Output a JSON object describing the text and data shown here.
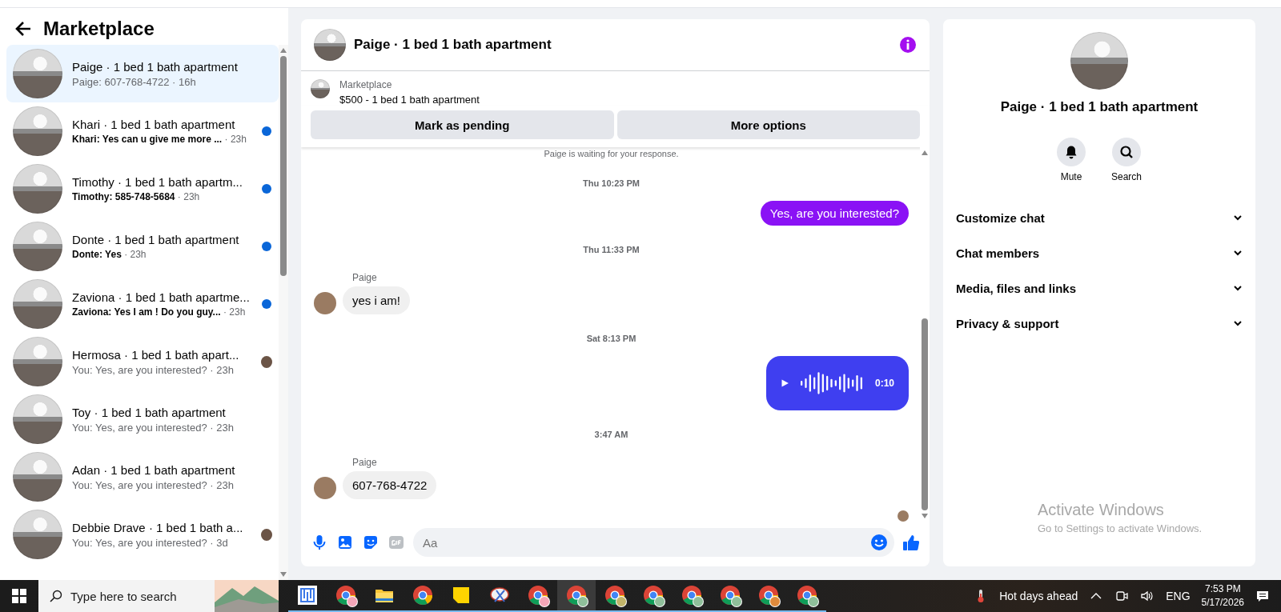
{
  "sidebar": {
    "title": "Marketplace",
    "separator": "·",
    "conversations": [
      {
        "title": "Paige · 1 bed 1 bath apartment",
        "preview": "Paige: 607-768-4722",
        "time": "16h",
        "selected": true,
        "unread": false,
        "seen_avatar": false
      },
      {
        "title": "Khari · 1 bed 1 bath apartment",
        "preview": "Khari: Yes can u give me more ...",
        "time": "23h",
        "selected": false,
        "unread": true,
        "seen_avatar": false
      },
      {
        "title": "Timothy · 1 bed 1 bath apartm...",
        "preview": "Timothy: 585-748-5684",
        "time": "23h",
        "selected": false,
        "unread": true,
        "seen_avatar": false
      },
      {
        "title": "Donte · 1 bed 1 bath apartment",
        "preview": "Donte: Yes",
        "time": "23h",
        "selected": false,
        "unread": true,
        "seen_avatar": false
      },
      {
        "title": "Zaviona · 1 bed 1 bath apartme...",
        "preview": "Zaviona: Yes I am ! Do you guy...",
        "time": "23h",
        "selected": false,
        "unread": true,
        "seen_avatar": false
      },
      {
        "title": "Hermosa · 1 bed 1 bath apart...",
        "preview": "You: Yes, are you interested?",
        "time": "23h",
        "selected": false,
        "unread": false,
        "seen_avatar": true
      },
      {
        "title": "Toy · 1 bed 1 bath apartment",
        "preview": "You: Yes, are you interested?",
        "time": "23h",
        "selected": false,
        "unread": false,
        "seen_avatar": false
      },
      {
        "title": "Adan · 1 bed 1 bath apartment",
        "preview": "You: Yes, are you interested?",
        "time": "23h",
        "selected": false,
        "unread": false,
        "seen_avatar": false
      },
      {
        "title": "Debbie Drave · 1 bed 1 bath a...",
        "preview": "You: Yes, are you interested?",
        "time": "3d",
        "selected": false,
        "unread": false,
        "seen_avatar": true
      }
    ]
  },
  "chat": {
    "title": "Paige · 1 bed 1 bath apartment",
    "listing": {
      "source": "Marketplace",
      "title": "$500 - 1 bed 1 bath apartment"
    },
    "buttons": [
      "Mark as pending",
      "More options"
    ],
    "messages": [
      {
        "kind": "status",
        "text": "Paige is waiting for your response."
      },
      {
        "kind": "timestamp",
        "text": "Thu 10:23 PM"
      },
      {
        "kind": "outgoing",
        "text": "Yes, are you interested?"
      },
      {
        "kind": "timestamp",
        "text": "Thu 11:33 PM"
      },
      {
        "kind": "incoming",
        "sender": "Paige",
        "text": "yes i am!"
      },
      {
        "kind": "timestamp",
        "text": "Sat 8:13 PM"
      },
      {
        "kind": "voice",
        "text": "0:10"
      },
      {
        "kind": "timestamp",
        "text": "3:47 AM"
      },
      {
        "kind": "incoming",
        "sender": "Paige",
        "text": "607-768-4722"
      },
      {
        "kind": "seen"
      }
    ],
    "composer": {
      "placeholder": "Aa"
    }
  },
  "details": {
    "title": "Paige · 1 bed 1 bath apartment",
    "actions": [
      {
        "kind": "bell",
        "label": "Mute"
      },
      {
        "kind": "search",
        "label": "Search"
      }
    ],
    "sections": [
      {
        "label": "Customize chat",
        "expanded": false
      },
      {
        "label": "Chat members",
        "expanded": false
      },
      {
        "label": "Media, files and links",
        "expanded": false
      },
      {
        "label": "Privacy & support",
        "expanded": false
      }
    ]
  },
  "activation_notice": {
    "title": "Activate Windows",
    "subtitle": "Go to Settings to activate Windows."
  },
  "taskbar": {
    "search_placeholder": "Type here to search",
    "apps": [
      {
        "kind": "maze",
        "active": false,
        "open": true
      },
      {
        "kind": "chrome",
        "color": "#f4a6b8",
        "active": false,
        "open": true
      },
      {
        "kind": "folder",
        "active": false,
        "open": true
      },
      {
        "kind": "chrome",
        "active": false,
        "open": true
      },
      {
        "kind": "sticky",
        "active": false,
        "open": true
      },
      {
        "kind": "snip",
        "active": false,
        "open": true
      },
      {
        "kind": "chrome",
        "color": "#f4a6b8",
        "active": false,
        "open": true
      },
      {
        "kind": "chrome",
        "color": "#8fbf9a",
        "active": true,
        "open": true
      },
      {
        "kind": "chrome",
        "color": "#c2b46a",
        "active": false,
        "open": true
      },
      {
        "kind": "chrome",
        "color": "#8fbf9a",
        "active": false,
        "open": true
      },
      {
        "kind": "chrome",
        "color": "#8fbf9a",
        "active": false,
        "open": true
      },
      {
        "kind": "chrome",
        "color": "#8fbf9a",
        "active": false,
        "open": true
      },
      {
        "kind": "chrome",
        "color": "#e08a3c",
        "active": false,
        "open": true
      },
      {
        "kind": "chrome",
        "color": "#8fbf9a",
        "active": false,
        "open": true
      }
    ],
    "weather": "Hot days ahead",
    "language": "ENG",
    "time": "7:53 PM",
    "date": "5/17/2026"
  }
}
